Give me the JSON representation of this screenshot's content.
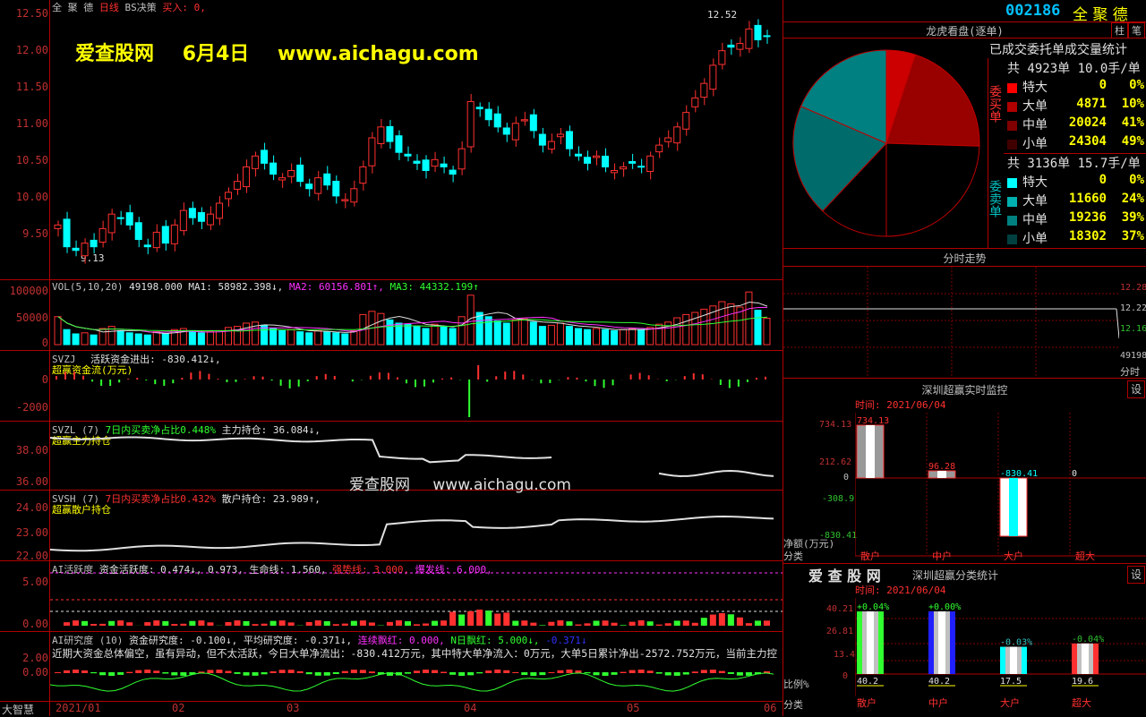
{
  "header": {
    "stock_name": "全 聚 德",
    "chart_type": "日线",
    "strategy_label": "BS决策",
    "buy_label": "买入: 0,",
    "watermark_title": "爱查股网",
    "watermark_date": "6月4日",
    "watermark_url": "www.aichagu.com",
    "high_marker": "12.52",
    "low_marker": "9.13"
  },
  "price_axis": [
    "12.50",
    "12.00",
    "11.50",
    "11.00",
    "10.50",
    "10.00",
    "9.50"
  ],
  "vol": {
    "title": "VOL(5,10,20)",
    "value": "49198.000",
    "ma1": "MA1: 58982.398↓,",
    "ma2": "MA2: 60156.801↑,",
    "ma3": "MA3: 44332.199↑",
    "axis": [
      "100000",
      "50000",
      "0"
    ]
  },
  "svzj": {
    "title": "SVZJ",
    "label": "活跃资金进出: -830.412↓,",
    "sub": "超赢资金流(万元)",
    "axis": [
      "0",
      "-2000"
    ]
  },
  "svzl": {
    "title": "SVZL",
    "param": "(7)",
    "ratio": "7日内买卖净占比0.448%",
    "hold": "主力持仓: 36.084↓,",
    "sub": "超赢主力持仓",
    "axis": [
      "38.00",
      "36.00"
    ]
  },
  "svsh": {
    "title": "SVSH",
    "param": "(7)",
    "ratio": "7日内买卖净占比0.432%",
    "hold": "散户持仓: 23.989↑,",
    "sub": "超赢散户持仓",
    "axis": [
      "24.00",
      "23.00",
      "22.00"
    ]
  },
  "ai_active": {
    "title": "AI活跃度",
    "a1": "资金活跃度: 0.474↓,",
    "a2": "0.973,",
    "a3": "生命线: 1.560,",
    "a4": "强势线: 3.000,",
    "a5": "爆发线: 6.000,",
    "axis": [
      "5.00",
      "0.00"
    ]
  },
  "ai_research": {
    "title": "AI研究度",
    "param": "(10)",
    "r1": "资金研究度: -0.100↓,",
    "r2": "平均研究度: -0.371↓,",
    "r3": "连续飘红: 0.000,",
    "r4": "N日飘红: 5.000↓,",
    "r5": "-0.371↓",
    "note": "近期大资金总体偏空，虽有异动，但不太活跃，今日大单净流出：-830.412万元，其中特大单净流入：0万元，大单5日累计净出-2572.752万元，当前主力控",
    "axis": [
      "2.00",
      "0.00"
    ]
  },
  "time_axis": [
    "2021/01",
    "02",
    "03",
    "04",
    "05",
    "06"
  ],
  "corner_label": "大智慧",
  "right": {
    "code": "002186",
    "name": "全 聚 德",
    "btn_col": "柱",
    "btn_note": "笔",
    "pie_title": "龙虎看盘(逐单)",
    "stat_title": "已成交委托单成交量统计",
    "buy_side_label": "委买单",
    "sell_side_label": "委卖单",
    "buy_total": "共 4923单 10.0手/单",
    "sell_total": "共 3136单 15.7手/单",
    "buy_rows": [
      {
        "label": "特大",
        "value": "0",
        "pct": "0%",
        "color": "#ff0000"
      },
      {
        "label": "大单",
        "value": "4871",
        "pct": "10%",
        "color": "#b00000"
      },
      {
        "label": "中单",
        "value": "20024",
        "pct": "41%",
        "color": "#800000"
      },
      {
        "label": "小单",
        "value": "24304",
        "pct": "49%",
        "color": "#400000"
      }
    ],
    "sell_rows": [
      {
        "label": "特大",
        "value": "0",
        "pct": "0%",
        "color": "#00ffff"
      },
      {
        "label": "大单",
        "value": "11660",
        "pct": "24%",
        "color": "#00b0b0"
      },
      {
        "label": "中单",
        "value": "19236",
        "pct": "39%",
        "color": "#008080"
      },
      {
        "label": "小单",
        "value": "18302",
        "pct": "37%",
        "color": "#004040"
      }
    ],
    "pie_slices": [
      {
        "pct": 5,
        "color": "#cc0000"
      },
      {
        "pct": 20.5,
        "color": "#990000"
      },
      {
        "pct": 24.5,
        "color": "#000000"
      },
      {
        "pct": 12,
        "color": "#000000"
      },
      {
        "pct": 19.5,
        "color": "#006b6b"
      },
      {
        "pct": 18.5,
        "color": "#008080"
      }
    ],
    "intraday_title": "分时走势",
    "intraday_axis": [
      "12.28",
      "12.22",
      "12.16"
    ],
    "intraday_vol": "49198",
    "intraday_vol_label": "分时",
    "monitor_title": "深圳超赢实时监控",
    "monitor_time": "时间: 2021/06/04",
    "monitor_btn": "设",
    "monitor_axis": [
      "734.13",
      "212.62",
      "0",
      "-308.9",
      "-830.41"
    ],
    "monitor_values": [
      "734.13",
      "96.28",
      "-830.41",
      "0"
    ],
    "monitor_unit": "净额(万元)",
    "monitor_cat": "分类",
    "categories": [
      "散户",
      "中户",
      "大户",
      "超大"
    ],
    "class_brand": "爱 查 股 网",
    "class_title": "深圳超赢分类统计",
    "class_time": "时间: 2021/06/04",
    "class_btn": "设",
    "class_axis": [
      "40.21",
      "26.81",
      "13.4",
      "0"
    ],
    "class_pct": [
      "+0.04%",
      "+0.00%",
      "-0.03%",
      "-0.04%"
    ],
    "class_values": [
      "40.2",
      "40.2",
      "17.5",
      "19.6"
    ],
    "class_ratio_label": "比例%",
    "class_cat_label": "分类"
  },
  "chart_data": [
    {
      "type": "candlestick",
      "title": "全聚德 日线",
      "ylim": [
        9.0,
        12.6
      ],
      "annotations": {
        "high": 12.52,
        "low": 9.13
      },
      "close": [
        9.6,
        9.3,
        9.25,
        9.35,
        9.3,
        9.55,
        9.75,
        9.7,
        9.6,
        9.4,
        9.3,
        9.5,
        9.35,
        9.6,
        9.8,
        9.7,
        9.65,
        9.75,
        9.9,
        10.05,
        10.2,
        10.4,
        10.55,
        10.45,
        10.3,
        10.25,
        10.35,
        10.2,
        10.1,
        10.25,
        10.15,
        10.0,
        9.95,
        10.1,
        10.4,
        10.8,
        10.95,
        10.75,
        10.6,
        10.55,
        10.45,
        10.35,
        10.5,
        10.4,
        10.3,
        10.65,
        11.3,
        11.2,
        11.05,
        10.95,
        10.85,
        11.0,
        11.05,
        10.9,
        10.7,
        10.75,
        10.85,
        10.65,
        10.55,
        10.45,
        10.55,
        10.4,
        10.35,
        10.4,
        10.45,
        10.4,
        10.55,
        10.7,
        10.8,
        10.95,
        11.15,
        11.35,
        11.55,
        11.8,
        12.0,
        12.05,
        12.1,
        12.3,
        12.15,
        12.2
      ]
    },
    {
      "type": "bar",
      "title": "VOL(5,10,20)",
      "ylim": [
        0,
        110000
      ],
      "values": [
        52000,
        28000,
        20000,
        22000,
        18000,
        30000,
        34000,
        26000,
        22000,
        20000,
        18000,
        24000,
        20000,
        28000,
        30000,
        26000,
        22000,
        24000,
        26000,
        32000,
        34000,
        40000,
        42000,
        36000,
        30000,
        26000,
        28000,
        24000,
        22000,
        26000,
        24000,
        22000,
        20000,
        26000,
        56000,
        62000,
        58000,
        46000,
        40000,
        38000,
        34000,
        30000,
        38000,
        34000,
        30000,
        52000,
        92000,
        60000,
        52000,
        44000,
        40000,
        46000,
        48000,
        42000,
        34000,
        36000,
        40000,
        34000,
        30000,
        28000,
        30000,
        28000,
        26000,
        28000,
        30000,
        28000,
        32000,
        38000,
        42000,
        50000,
        56000,
        60000,
        66000,
        72000,
        80000,
        76000,
        70000,
        98000,
        64000,
        49198
      ]
    }
  ]
}
